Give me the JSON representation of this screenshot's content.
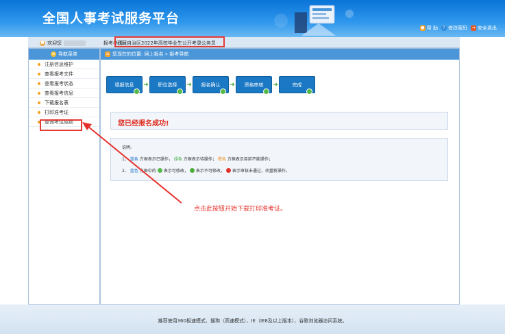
{
  "header": {
    "title": "全国人事考试服务平台",
    "links": [
      {
        "label": "帮 助",
        "icon": "lock-icon",
        "color": "#f2a22d"
      },
      {
        "label": "修改密码",
        "icon": "question-icon",
        "color": "#2f89d8"
      },
      {
        "label": "安全退出",
        "icon": "exit-icon",
        "color": "#e05a2a"
      }
    ]
  },
  "infobar": {
    "welcome": "欢迎您",
    "exam_label": "报考考试:",
    "exam_name": "西藏自治区2022年高校毕业生公开考录公务员"
  },
  "sidebar": {
    "head": "导航菜单",
    "items": [
      "注册信息维护",
      "查看报考文件",
      "查看报考状态",
      "查看报考信息",
      "下载报名表",
      "打印准考证",
      "查询考试成绩"
    ]
  },
  "breadcrumb": {
    "text": "您现在的位置: 网上报名 » 报考导航"
  },
  "steps": [
    "填报信息",
    "职位选择",
    "报名确认",
    "资格审核",
    "完成"
  ],
  "success_message": "您已经报名成功!",
  "explanation": {
    "title": "说明:",
    "line1": {
      "num": "1、",
      "blue": "蓝色",
      "a": "方框表示已操作，",
      "green": "绿色",
      "b": "方框表示待操作；",
      "orange": "橙色",
      "c": "方框表示目前不能操作；"
    },
    "line2": {
      "num": "2、",
      "blue": "蓝色",
      "a": "方框中的",
      "b": "表示可修改，",
      "c": "表示不可修改，",
      "d": "表示审核未通过，须重新操作。"
    }
  },
  "annotation": "点击此按钮开始下载打印准考证。",
  "footer": "推荐使用360极速模式、搜狗（高速模式）、IE（IE8及以上版本）、谷歌浏览器访问系统。",
  "colors": {
    "header": "#0a74d8",
    "nav_bar": "#4a96d9",
    "step": "#1a78c4",
    "highlight": "#e43a35",
    "success": "#e02b1f"
  }
}
